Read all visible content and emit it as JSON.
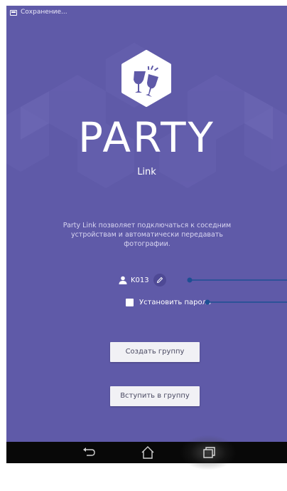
{
  "status_bar": {
    "icon": "screenshot-icon",
    "text": "Сохранение..."
  },
  "app": {
    "title": "PARTY",
    "subtitle": "Link",
    "description_line1": "Party Link позволяет подключаться к соседним",
    "description_line2": "устройствам и автоматически передавать",
    "description_line3": "фотографии."
  },
  "user": {
    "name": "K013",
    "icon": "person-icon",
    "edit_icon": "pencil-icon"
  },
  "password": {
    "label": "Установить пароль",
    "checked": false
  },
  "buttons": {
    "create_group": "Создать группу",
    "join_group": "Вступить в группу"
  },
  "nav": {
    "back": "back-icon",
    "home": "home-icon",
    "recents": "recents-icon"
  },
  "colors": {
    "background": "#5f5aa8",
    "accent": "#2a5a9a",
    "navbar": "#080808"
  }
}
